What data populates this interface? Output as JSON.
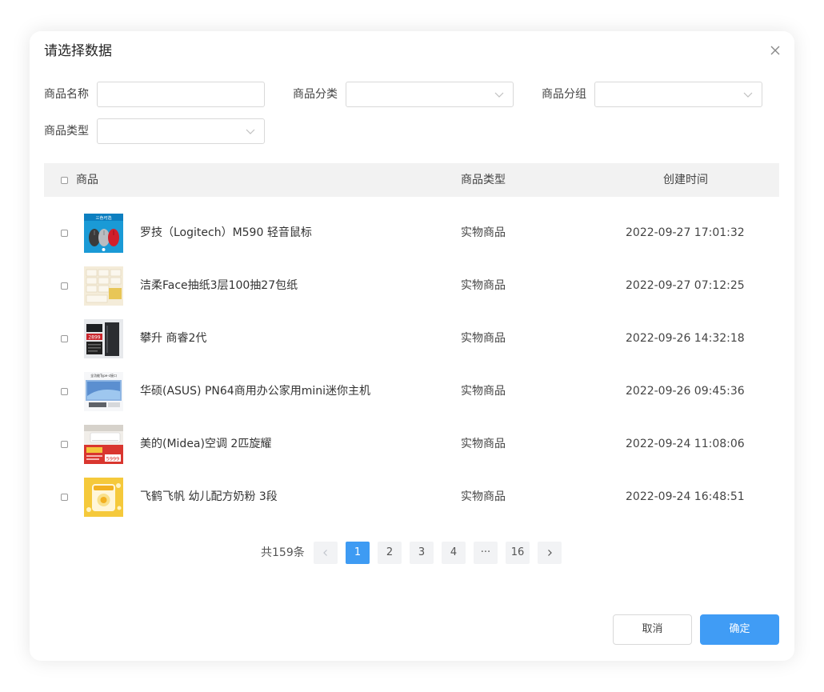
{
  "dialog": {
    "title": "请选择数据"
  },
  "filters": {
    "product_name": {
      "label": "商品名称",
      "value": "",
      "placeholder": ""
    },
    "product_category": {
      "label": "商品分类",
      "value": ""
    },
    "product_group": {
      "label": "商品分组",
      "value": ""
    },
    "product_type": {
      "label": "商品类型",
      "value": ""
    }
  },
  "table": {
    "headers": {
      "product": "商品",
      "type": "商品类型",
      "created": "创建时间"
    },
    "rows": [
      {
        "name": "罗技（Logitech）M590 轻音鼠标",
        "type": "实物商品",
        "created": "2022-09-27 17:01:32",
        "thumb": "mouse-product-image",
        "thumb_text": "三色可选"
      },
      {
        "name": "洁柔Face抽纸3层100抽27包纸",
        "type": "实物商品",
        "created": "2022-09-27 07:12:25",
        "thumb": "tissue-product-image",
        "thumb_text": ""
      },
      {
        "name": "攀升 商睿2代",
        "type": "实物商品",
        "created": "2022-09-26 14:32:18",
        "thumb": "desktop-pc-product-image",
        "thumb_text": "2899"
      },
      {
        "name": "华硕(ASUS) PN64商用办公家用mini迷你主机",
        "type": "实物商品",
        "created": "2022-09-26 09:45:36",
        "thumb": "mini-pc-product-image",
        "thumb_text": "全功能Type-c接口"
      },
      {
        "name": "美的(Midea)空调 2匹旋耀",
        "type": "实物商品",
        "created": "2022-09-24 11:08:06",
        "thumb": "air-conditioner-product-image",
        "thumb_text": "5999"
      },
      {
        "name": "飞鹤飞帆 幼儿配方奶粉 3段",
        "type": "实物商品",
        "created": "2022-09-24 16:48:51",
        "thumb": "milk-powder-product-image",
        "thumb_text": ""
      }
    ]
  },
  "pagination": {
    "total": "共159条",
    "pages": [
      "1",
      "2",
      "3",
      "4",
      "···",
      "16"
    ],
    "current": "1"
  },
  "footer": {
    "cancel_label": "取消",
    "confirm_label": "确定"
  },
  "colors": {
    "accent": "#409cf5",
    "header_bg": "#f2f2f2",
    "pager_bg": "#f2f3f5"
  }
}
